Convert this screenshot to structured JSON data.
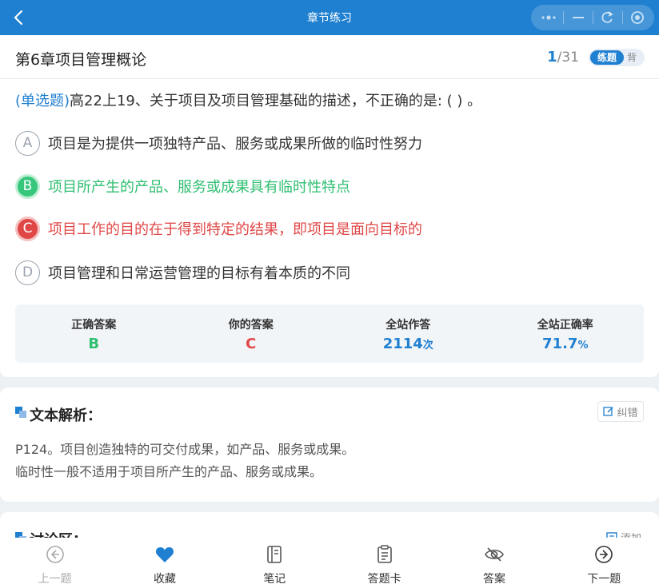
{
  "app": {
    "title": "章节练习",
    "colors": {
      "primary": "#1f7fd0",
      "correct": "#2fbf71",
      "wrong": "#e04848"
    }
  },
  "header": {
    "chapter_title": "第6章项目管理概论",
    "progress_current": "1",
    "progress_total": "/31",
    "mode_practice": "练题",
    "mode_recite": "背"
  },
  "question": {
    "type_label": "(单选题)",
    "text": "高22上19、关于项目及项目管理基础的描述，不正确的是: (          ) 。",
    "options": [
      {
        "letter": "A",
        "text": "项目是为提供一项独特产品、服务或成果所做的临时性努力",
        "state": "normal"
      },
      {
        "letter": "B",
        "text": "项目所产生的产品、服务或成果具有临时性特点",
        "state": "correct"
      },
      {
        "letter": "C",
        "text": "项目工作的目的在于得到特定的结果，即项目是面向目标的",
        "state": "wrong"
      },
      {
        "letter": "D",
        "text": "项目管理和日常运营管理的目标有着本质的不同",
        "state": "normal"
      }
    ]
  },
  "stats": {
    "correct_label": "正确答案",
    "correct_value": "B",
    "yours_label": "你的答案",
    "yours_value": "C",
    "attempts_label": "全站作答",
    "attempts_value": "2114",
    "attempts_unit": "次",
    "rate_label": "全站正确率",
    "rate_value": "71.7",
    "rate_unit": "%"
  },
  "analysis": {
    "title": "文本解析：",
    "fix_label": "纠错",
    "lines": [
      "P124。项目创造独特的可交付成果，如产品、服务或成果。",
      "临时性一般不适用于项目所产生的产品、服务或成果。"
    ]
  },
  "discussion": {
    "title": "讨论区：",
    "add_label": "添加"
  },
  "bottom_nav": [
    {
      "label": "上一题",
      "icon": "arrow-left-circle-icon",
      "disabled": true
    },
    {
      "label": "收藏",
      "icon": "heart-icon",
      "disabled": false
    },
    {
      "label": "笔记",
      "icon": "notebook-icon",
      "disabled": false
    },
    {
      "label": "答题卡",
      "icon": "clipboard-icon",
      "disabled": false
    },
    {
      "label": "答案",
      "icon": "eye-hidden-icon",
      "disabled": false
    },
    {
      "label": "下一题",
      "icon": "arrow-right-circle-icon",
      "disabled": false
    }
  ]
}
